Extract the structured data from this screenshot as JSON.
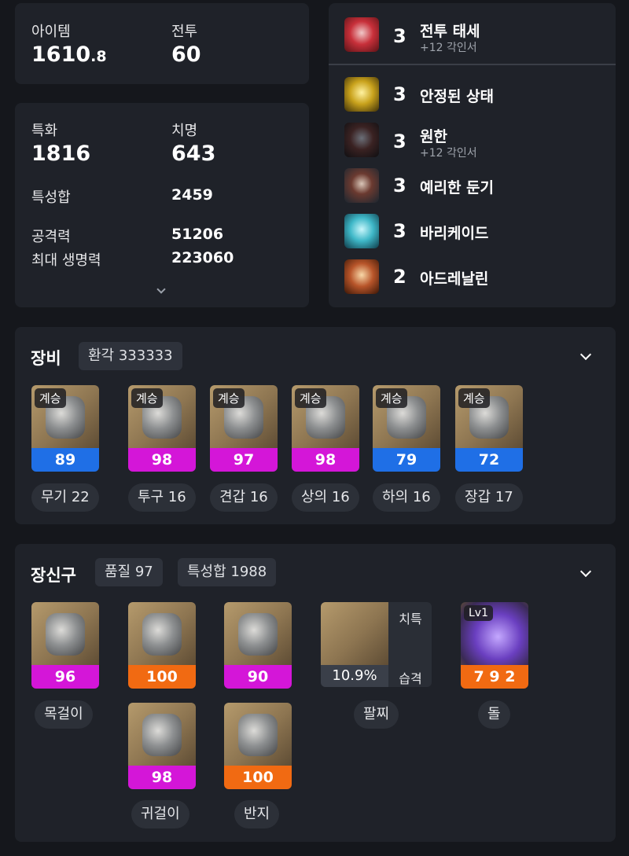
{
  "item_level": {
    "label": "아이템",
    "value_main": "1610",
    "value_dec": ".8"
  },
  "combat": {
    "label": "전투",
    "value": "60"
  },
  "stats": {
    "spec_label": "특화",
    "spec_value": "1816",
    "crit_label": "치명",
    "crit_value": "643",
    "total_label": "특성합",
    "total_value": "2459",
    "attack_label": "공격력",
    "attack_value": "51206",
    "hp_label": "최대 생명력",
    "hp_value": "223060"
  },
  "engravings": [
    {
      "level": "3",
      "name": "전투 태세",
      "sub": "+12 각인서",
      "color": "#c8303a"
    },
    {
      "level": "3",
      "name": "안정된 상태",
      "sub": "",
      "color": "#c9a21c"
    },
    {
      "level": "3",
      "name": "원한",
      "sub": "+12 각인서",
      "color": "#7a2a28"
    },
    {
      "level": "3",
      "name": "예리한 둔기",
      "sub": "",
      "color": "#3c4a5a"
    },
    {
      "level": "3",
      "name": "바리케이드",
      "sub": "",
      "color": "#3fb8c8"
    },
    {
      "level": "2",
      "name": "아드레날린",
      "sub": "",
      "color": "#b8552a"
    }
  ],
  "equipment": {
    "title": "장비",
    "tag": "환각 333333",
    "items": [
      {
        "badge": "계승",
        "quality": "89",
        "quality_color": "#1f6fe6",
        "label": "무기 22"
      },
      {
        "badge": "계승",
        "quality": "98",
        "quality_color": "#d416d8",
        "label": "투구 16"
      },
      {
        "badge": "계승",
        "quality": "97",
        "quality_color": "#d416d8",
        "label": "견갑 16"
      },
      {
        "badge": "계승",
        "quality": "98",
        "quality_color": "#d416d8",
        "label": "상의 16"
      },
      {
        "badge": "계승",
        "quality": "79",
        "quality_color": "#1f6fe6",
        "label": "하의 16"
      },
      {
        "badge": "계승",
        "quality": "72",
        "quality_color": "#1f6fe6",
        "label": "장갑 17"
      }
    ]
  },
  "accessories": {
    "title": "장신구",
    "tag_quality": "품질 97",
    "tag_stats": "특성합 1988",
    "necklace": {
      "quality": "96",
      "label": "목걸이"
    },
    "earring1": {
      "quality": "100"
    },
    "earring2": {
      "quality": "98",
      "label": "귀걸이"
    },
    "ring1": {
      "quality": "90"
    },
    "ring2": {
      "quality": "100",
      "label": "반지"
    },
    "bracelet": {
      "value": "10.9%",
      "stat1": "치특",
      "stat2": "습격",
      "label": "팔찌"
    },
    "stone": {
      "level": "Lv1",
      "value": "7 9 2",
      "label": "돌"
    }
  }
}
